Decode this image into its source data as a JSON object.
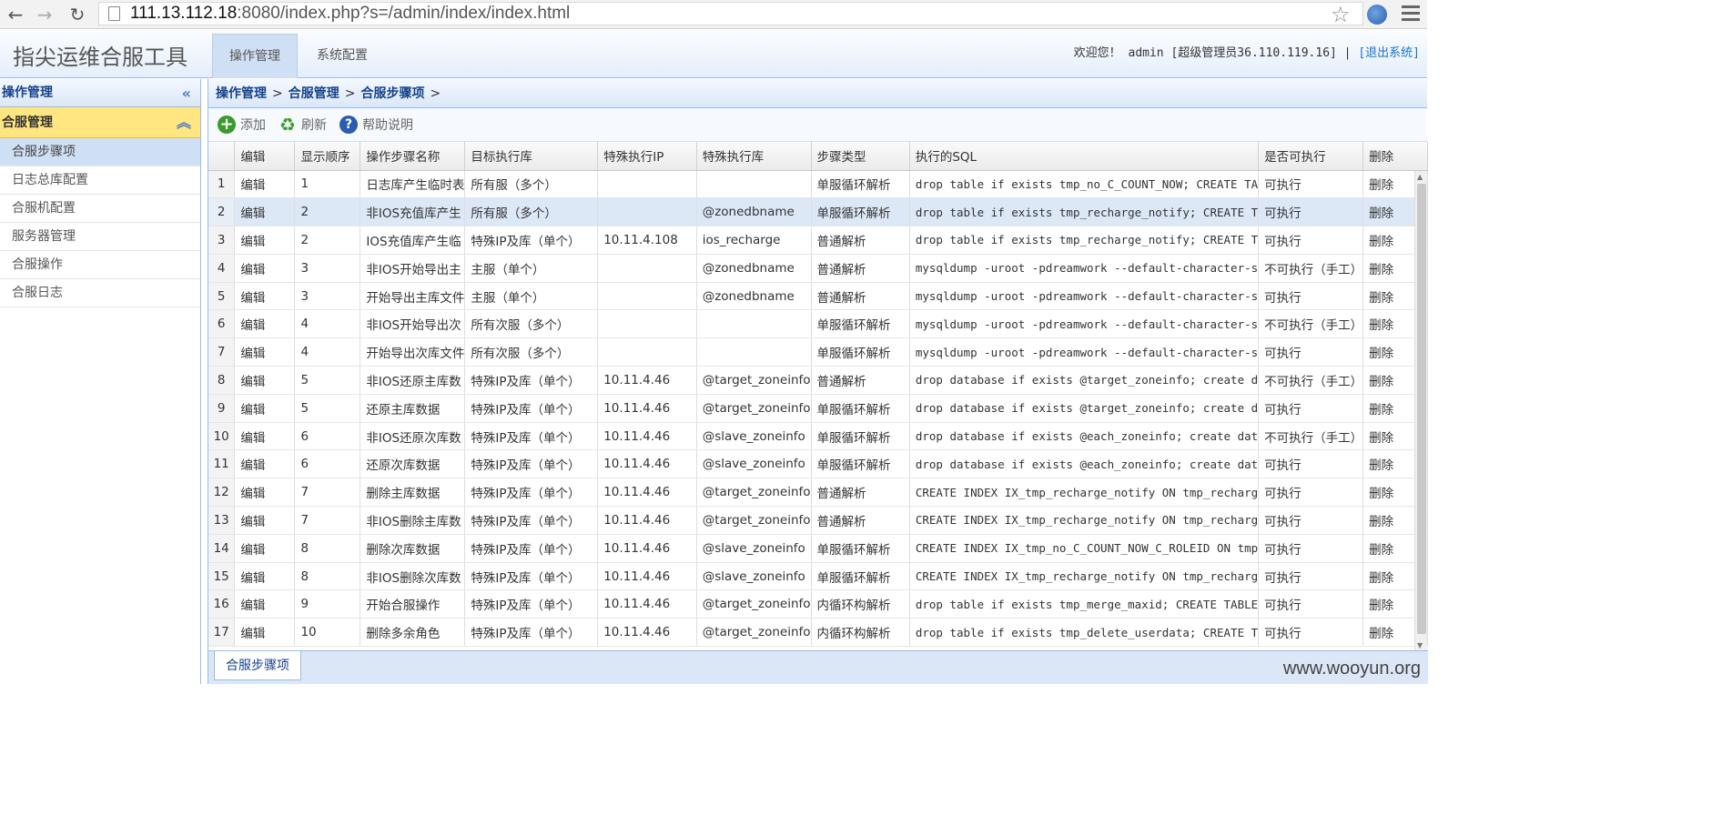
{
  "browser": {
    "url_host": "111.13.112.18",
    "url_rest": ":8080/index.php?s=/admin/index/index.html",
    "back_glyph": "←",
    "forward_glyph": "→",
    "reload_glyph": "↻",
    "star_glyph": "☆"
  },
  "header": {
    "app_title": "指尖运维合服工具",
    "tabs": [
      "操作管理",
      "系统配置"
    ],
    "welcome": "欢迎您！ admin [超级管理员36.110.119.16] | ",
    "logout": "[退出系统]"
  },
  "sidebar": {
    "title": "操作管理",
    "collapse_glyph": "«",
    "group": "合服管理",
    "group_glyph": "︽",
    "items": [
      "合服步骤项",
      "日志总库配置",
      "合服机配置",
      "服务器管理",
      "合服操作",
      "合服日志"
    ]
  },
  "breadcrumb": [
    "操作管理",
    "合服管理",
    "合服步骤项"
  ],
  "breadcrumb_sep": ">",
  "toolbar": {
    "add": "添加",
    "refresh": "刷新",
    "help": "帮助说明",
    "add_glyph": "+",
    "refresh_glyph": "♻",
    "help_glyph": "?"
  },
  "grid": {
    "columns": [
      "编辑",
      "显示顺序",
      "操作步骤名称",
      "目标执行库",
      "特殊执行IP",
      "特殊执行库",
      "步骤类型",
      "执行的SQL",
      "是否可执行",
      "删除"
    ],
    "rows": [
      [
        "1",
        "编辑",
        "1",
        "日志库产生临时表",
        "所有服（多个）",
        "",
        "",
        "单服循环解析",
        "drop table if exists tmp_no_C_COUNT_NOW; CREATE TA",
        "可执行",
        "删除"
      ],
      [
        "2",
        "编辑",
        "2",
        "非IOS充值库产生",
        "所有服（多个）",
        "",
        "@zonedbname",
        "单服循环解析",
        "drop table if exists tmp_recharge_notify; CREATE T",
        "可执行",
        "删除"
      ],
      [
        "3",
        "编辑",
        "2",
        "IOS充值库产生临",
        "特殊IP及库（单个）",
        "10.11.4.108",
        "ios_recharge",
        "普通解析",
        "drop table if exists tmp_recharge_notify; CREATE T",
        "可执行",
        "删除"
      ],
      [
        "4",
        "编辑",
        "3",
        "非IOS开始导出主",
        "主服（单个）",
        "",
        "@zonedbname",
        "普通解析",
        "mysqldump -uroot -pdreamwork --default-character-s",
        "不可执行（手工）",
        "删除"
      ],
      [
        "5",
        "编辑",
        "3",
        "开始导出主库文件",
        "主服（单个）",
        "",
        "@zonedbname",
        "普通解析",
        "mysqldump -uroot -pdreamwork --default-character-s",
        "可执行",
        "删除"
      ],
      [
        "6",
        "编辑",
        "4",
        "非IOS开始导出次",
        "所有次服（多个）",
        "",
        "",
        "单服循环解析",
        "mysqldump -uroot -pdreamwork --default-character-s",
        "不可执行（手工）",
        "删除"
      ],
      [
        "7",
        "编辑",
        "4",
        "开始导出次库文件",
        "所有次服（多个）",
        "",
        "",
        "单服循环解析",
        "mysqldump -uroot -pdreamwork --default-character-s",
        "可执行",
        "删除"
      ],
      [
        "8",
        "编辑",
        "5",
        "非IOS还原主库数",
        "特殊IP及库（单个）",
        "10.11.4.46",
        "@target_zoneinfo",
        "普通解析",
        "drop database if exists @target_zoneinfo; create d",
        "不可执行（手工）",
        "删除"
      ],
      [
        "9",
        "编辑",
        "5",
        "还原主库数据",
        "特殊IP及库（单个）",
        "10.11.4.46",
        "@target_zoneinfo",
        "单服循环解析",
        "drop database if exists @target_zoneinfo; create d",
        "可执行",
        "删除"
      ],
      [
        "10",
        "编辑",
        "6",
        "非IOS还原次库数",
        "特殊IP及库（单个）",
        "10.11.4.46",
        "@slave_zoneinfo",
        "单服循环解析",
        "drop database if exists @each_zoneinfo; create dat",
        "不可执行（手工）",
        "删除"
      ],
      [
        "11",
        "编辑",
        "6",
        "还原次库数据",
        "特殊IP及库（单个）",
        "10.11.4.46",
        "@slave_zoneinfo",
        "单服循环解析",
        "drop database if exists @each_zoneinfo; create dat",
        "可执行",
        "删除"
      ],
      [
        "12",
        "编辑",
        "7",
        "删除主库数据",
        "特殊IP及库（单个）",
        "10.11.4.46",
        "@target_zoneinfo",
        "普通解析",
        "CREATE INDEX IX_tmp_recharge_notify ON tmp_recharg",
        "可执行",
        "删除"
      ],
      [
        "13",
        "编辑",
        "7",
        "非IOS删除主库数",
        "特殊IP及库（单个）",
        "10.11.4.46",
        "@target_zoneinfo",
        "普通解析",
        "CREATE INDEX IX_tmp_recharge_notify ON tmp_recharg",
        "可执行",
        "删除"
      ],
      [
        "14",
        "编辑",
        "8",
        "删除次库数据",
        "特殊IP及库（单个）",
        "10.11.4.46",
        "@slave_zoneinfo",
        "单服循环解析",
        "CREATE INDEX IX_tmp_no_C_COUNT_NOW_C_ROLEID ON tmp",
        "可执行",
        "删除"
      ],
      [
        "15",
        "编辑",
        "8",
        "非IOS删除次库数",
        "特殊IP及库（单个）",
        "10.11.4.46",
        "@slave_zoneinfo",
        "单服循环解析",
        "CREATE INDEX IX_tmp_recharge_notify ON tmp_recharg",
        "可执行",
        "删除"
      ],
      [
        "16",
        "编辑",
        "9",
        "开始合服操作",
        "特殊IP及库（单个）",
        "10.11.4.46",
        "@target_zoneinfo",
        "内循环构解析",
        "drop table if exists tmp_merge_maxid; CREATE TABLE",
        "可执行",
        "删除"
      ],
      [
        "17",
        "编辑",
        "10",
        "删除多余角色",
        "特殊IP及库（单个）",
        "10.11.4.46",
        "@target_zoneinfo",
        "内循环构解析",
        "drop table if exists tmp_delete_userdata; CREATE T",
        "可执行",
        "删除"
      ]
    ],
    "selected_row": 2
  },
  "bottom": {
    "tab": "合服步骤项",
    "watermark": "www.wooyun.org"
  }
}
